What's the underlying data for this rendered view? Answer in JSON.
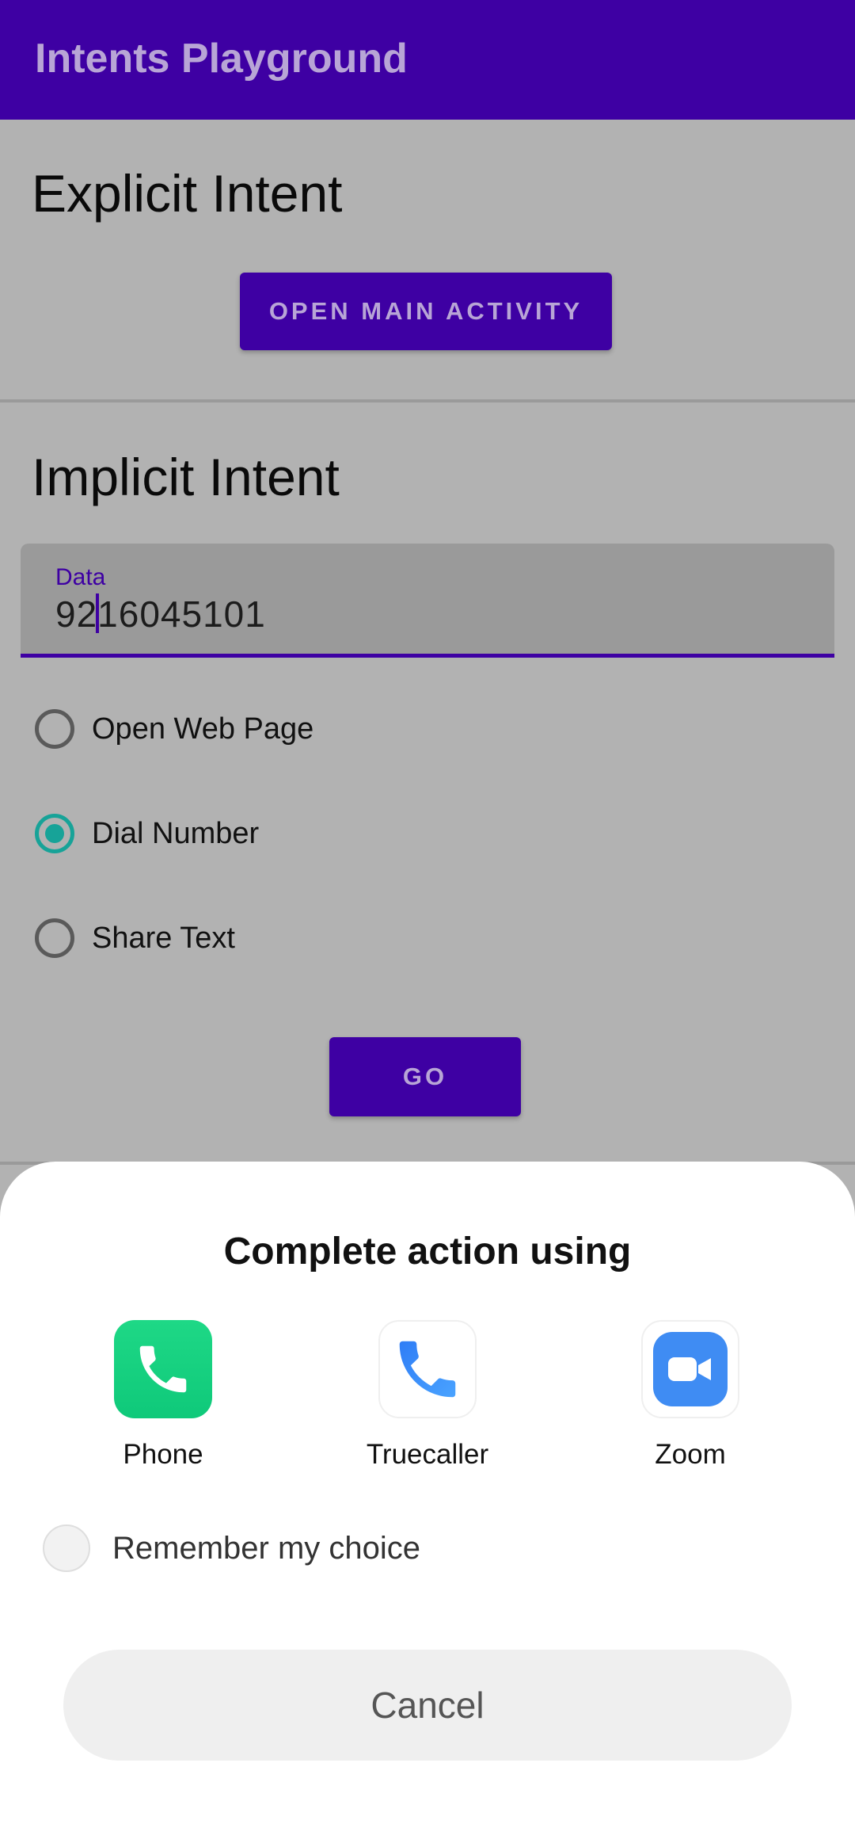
{
  "app": {
    "title": "Intents Playground",
    "accent": "#3e00a3"
  },
  "explicit": {
    "title": "Explicit Intent",
    "button_label": "OPEN MAIN ACTIVITY"
  },
  "implicit": {
    "title": "Implicit Intent",
    "field": {
      "label": "Data",
      "value_before_cursor": "92",
      "value_after_cursor": "16045101"
    },
    "options": [
      {
        "label": "Open Web Page",
        "checked": false
      },
      {
        "label": "Dial Number",
        "checked": true
      },
      {
        "label": "Share Text",
        "checked": false
      }
    ],
    "go_label": "GO"
  },
  "chooser": {
    "title": "Complete action using",
    "apps": [
      {
        "label": "Phone",
        "icon": "phone-icon"
      },
      {
        "label": "Truecaller",
        "icon": "truecaller-icon"
      },
      {
        "label": "Zoom",
        "icon": "zoom-icon"
      }
    ],
    "remember_label": "Remember my choice",
    "cancel_label": "Cancel"
  }
}
